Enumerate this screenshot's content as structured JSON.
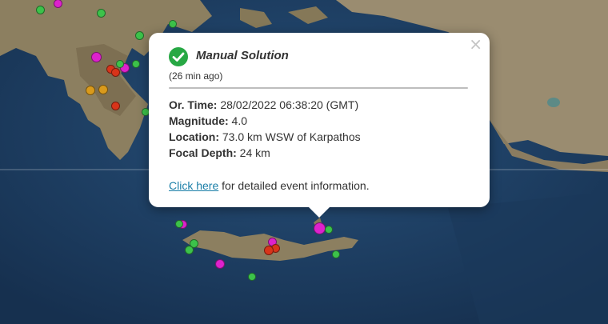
{
  "popup": {
    "title": "Manual Solution",
    "time_ago": "(26 min ago)",
    "fields": [
      {
        "label": "Or. Time:",
        "value": "28/02/2022 06:38:20 (GMT)"
      },
      {
        "label": "Magnitude:",
        "value": "4.0"
      },
      {
        "label": "Location:",
        "value": "73.0 km WSW of Karpathos"
      },
      {
        "label": "Focal Depth:",
        "value": "24 km"
      }
    ],
    "link_text": "Click here",
    "link_suffix": " for detailed event information.",
    "close_symbol": "×"
  },
  "colors": {
    "sea": "#1d3f63",
    "land": "#8f8266",
    "green": "#3cc24a",
    "magenta": "#dd22cc",
    "red": "#d8341a",
    "orange": "#d99a1c",
    "check": "#27a844"
  },
  "markers": [
    {
      "color": "green"
    },
    {
      "color": "magenta"
    },
    {
      "color": "green"
    },
    {
      "color": "green"
    },
    {
      "color": "magenta"
    },
    {
      "color": "red"
    },
    {
      "color": "red"
    },
    {
      "color": "magenta"
    },
    {
      "color": "green"
    },
    {
      "color": "green"
    },
    {
      "color": "orange"
    },
    {
      "color": "orange"
    },
    {
      "color": "red"
    },
    {
      "color": "green"
    },
    {
      "color": "green"
    },
    {
      "color": "magenta"
    },
    {
      "color": "green"
    },
    {
      "color": "green"
    },
    {
      "color": "green"
    },
    {
      "color": "magenta"
    },
    {
      "color": "red"
    },
    {
      "color": "red"
    },
    {
      "color": "magenta"
    },
    {
      "color": "magenta"
    },
    {
      "color": "green"
    },
    {
      "color": "green"
    },
    {
      "color": "green"
    }
  ]
}
